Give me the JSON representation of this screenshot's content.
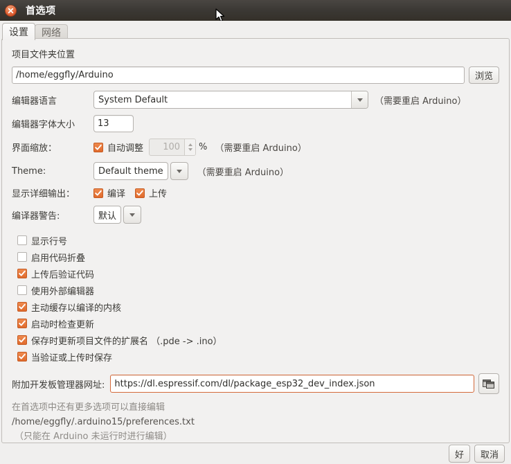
{
  "window": {
    "title": "首选项",
    "close_icon": "close-icon"
  },
  "tabs": [
    {
      "label": "设置",
      "active": true
    },
    {
      "label": "网络",
      "active": false
    }
  ],
  "form": {
    "sketchbook": {
      "label": "项目文件夹位置",
      "value": "/home/eggfly/Arduino",
      "browse_label": "浏览"
    },
    "language": {
      "label": "编辑器语言",
      "value": "System Default",
      "note": "（需要重启 Arduino）"
    },
    "font_size": {
      "label": "编辑器字体大小",
      "value": "13"
    },
    "scaling": {
      "label": "界面缩放：",
      "auto_label": "自动调整",
      "auto_checked": true,
      "percent_value": "100",
      "percent_unit": "%",
      "note": "（需要重启 Arduino）"
    },
    "theme": {
      "label": "Theme:",
      "value": "Default theme",
      "note": "（需要重启 Arduino）"
    },
    "verbose": {
      "label": "显示详细输出：",
      "compile_label": "编译",
      "compile_checked": true,
      "upload_label": "上传",
      "upload_checked": true
    },
    "warnings": {
      "label": "编译器警告:",
      "value": "默认"
    },
    "options": [
      {
        "label": "显示行号",
        "checked": false
      },
      {
        "label": "启用代码折叠",
        "checked": false
      },
      {
        "label": "上传后验证代码",
        "checked": true
      },
      {
        "label": "使用外部编辑器",
        "checked": false
      },
      {
        "label": "主动缓存以编译的内核",
        "checked": true
      },
      {
        "label": "启动时检查更新",
        "checked": true
      },
      {
        "label": "保存时更新项目文件的扩展名 （.pde -> .ino）",
        "checked": true
      },
      {
        "label": "当验证或上传时保存",
        "checked": true
      }
    ],
    "board_urls": {
      "label": "附加开发板管理器网址:",
      "value": "https://dl.espressif.com/dl/package_esp32_dev_index.json",
      "copy_icon": "copy-windows-icon"
    },
    "notes": {
      "line1": "在首选项中还有更多选项可以直接编辑",
      "line2": "/home/eggfly/.arduino15/preferences.txt",
      "line3": "（只能在 Arduino 未运行时进行编辑）"
    }
  },
  "footer": {
    "ok_label": "好",
    "cancel_label": "取消"
  },
  "colors": {
    "accent_orange": "#e06a2c",
    "titlebar": "#3b3834",
    "background": "#f0efee",
    "focus_border": "#d4693a"
  }
}
